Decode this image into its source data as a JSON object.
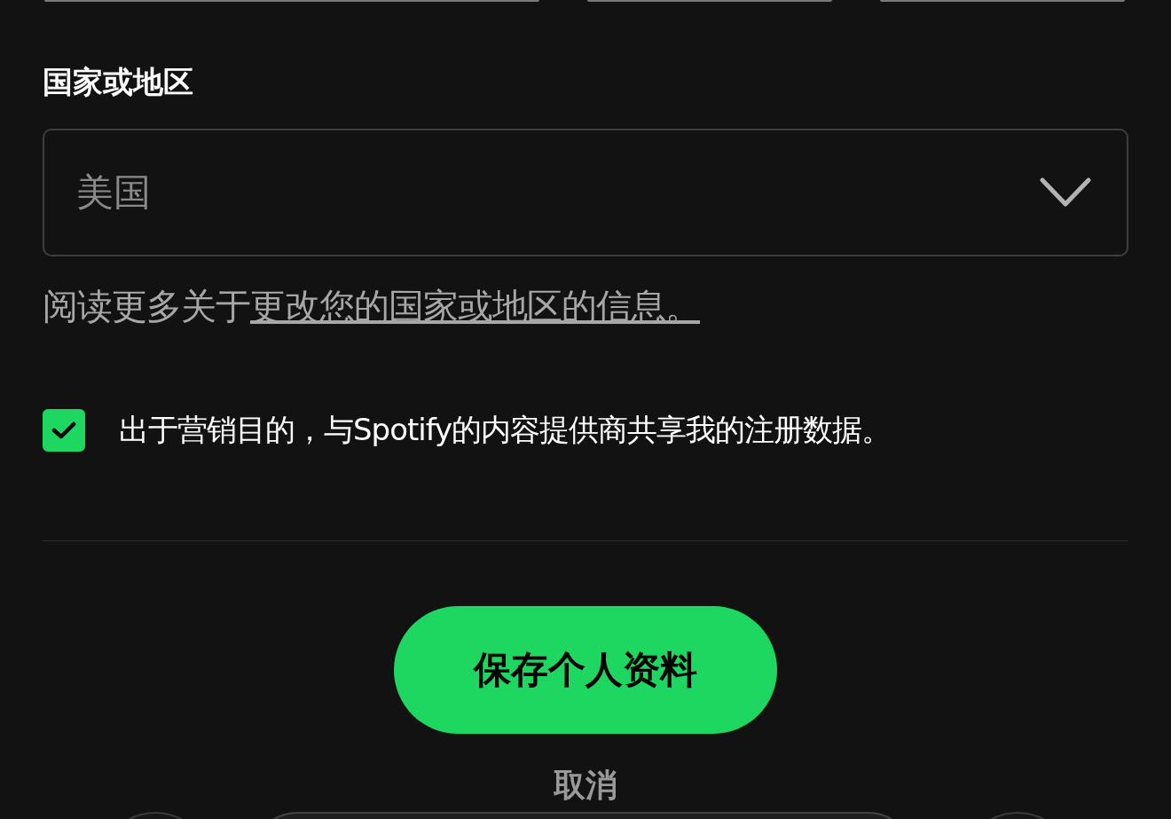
{
  "country": {
    "label": "国家或地区",
    "value": "美国"
  },
  "info": {
    "text": "阅读更多关于",
    "link": "更改您的国家或地区的信息。"
  },
  "marketing": {
    "label": "出于营销目的，与Spotify的内容提供商共享我的注册数据。",
    "checked": true
  },
  "save_button": "保存个人资料",
  "cancel": "取消"
}
